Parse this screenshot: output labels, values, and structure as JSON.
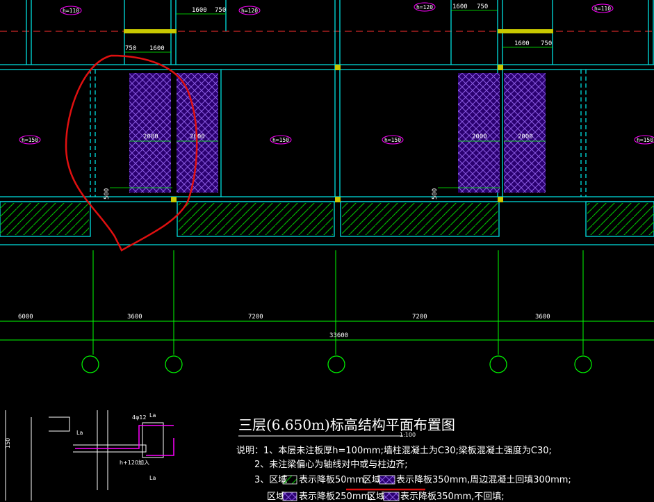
{
  "drawing": {
    "title": "三层(6.650m)标高结构平面布置图",
    "scale": "1:100"
  },
  "slab_tags": [
    "h=110",
    "h=120",
    "h=120",
    "h=110",
    "h=150",
    "h=150",
    "h=150",
    "h=150"
  ],
  "dims_top": [
    "750",
    "1600",
    "750",
    "750",
    "1600",
    "750",
    "1600",
    "750"
  ],
  "dims_room": [
    "2000",
    "2000",
    "2000",
    "2000"
  ],
  "dims_500": [
    "500",
    "500"
  ],
  "axis_dims": [
    "6000",
    "3600",
    "7200",
    "7200",
    "3600"
  ],
  "total_dim": "33600",
  "notes": {
    "line1": "说明：1、本层未注板厚h=100mm;墙柱混凝土为C30;梁板混凝土强度为C30;",
    "line2": "2、未注梁偏心为轴线对中或与柱边齐;",
    "line3_prefix": "3、区域",
    "line3_a": "表示降板50mm;",
    "line3_b_prefix": "区域",
    "line3_b": "表示降板350mm,周边混凝土回填300mm;",
    "line4_prefix": "区域",
    "line4_a": "表示降板250mm;",
    "line4_b_prefix": "区域",
    "line4_b": "表示降板350mm,不回填;"
  },
  "detail_labels": {
    "a": "4φ12",
    "b": "La",
    "c": "La",
    "d": "La",
    "e": "h+120加入",
    "f": "150"
  },
  "colors": {
    "background": "#000000",
    "wall": "#00ffff",
    "axis": "#00ff00",
    "hatch_purple": "#7a30c8",
    "hatch_green": "#00c000",
    "markup": "#e01010",
    "text": "#ffffff",
    "tag_ring": "#ff00ff"
  }
}
